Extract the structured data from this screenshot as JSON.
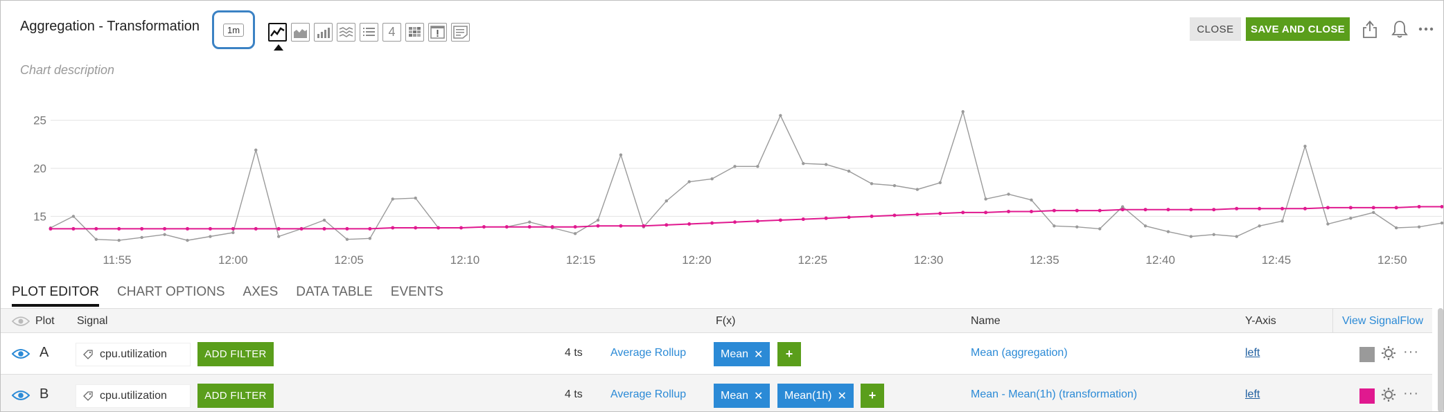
{
  "header": {
    "title": "Aggregation - Transformation",
    "resolution": "1m",
    "chart_type_count_label": "4",
    "close_label": "CLOSE",
    "save_label": "SAVE AND CLOSE",
    "icons": [
      "share-icon",
      "bell-icon",
      "more-icon"
    ]
  },
  "description_placeholder": "Chart description",
  "chart_data": {
    "type": "line",
    "x_labels": [
      "11:55",
      "12:00",
      "12:05",
      "12:10",
      "12:15",
      "12:20",
      "12:25",
      "12:30",
      "12:35",
      "12:40",
      "12:45",
      "12:50"
    ],
    "y_ticks": [
      15,
      20,
      25
    ],
    "ylim": [
      12,
      27
    ],
    "series": [
      {
        "color": "#9a9a9a",
        "values": [
          13.8,
          15.0,
          12.6,
          12.5,
          12.8,
          13.1,
          12.5,
          12.9,
          13.3,
          21.9,
          12.9,
          13.7,
          14.6,
          12.6,
          12.7,
          16.8,
          16.9,
          13.8,
          13.8,
          13.9,
          13.9,
          14.4,
          13.8,
          13.2,
          14.6,
          21.4,
          13.9,
          16.6,
          18.6,
          18.9,
          20.2,
          20.2,
          25.5,
          20.5,
          20.4,
          19.7,
          18.4,
          18.2,
          17.8,
          18.5,
          25.9,
          16.8,
          17.3,
          16.7,
          14.0,
          13.9,
          13.7,
          16.0,
          14.0,
          13.4,
          12.9,
          13.1,
          12.9,
          14.0,
          14.5,
          22.3,
          14.2,
          14.8,
          15.4,
          13.8,
          13.9,
          14.3
        ],
        "markers": true
      },
      {
        "color": "#e0198f",
        "values": [
          13.7,
          13.7,
          13.7,
          13.7,
          13.7,
          13.7,
          13.7,
          13.7,
          13.7,
          13.7,
          13.7,
          13.7,
          13.7,
          13.7,
          13.7,
          13.8,
          13.8,
          13.8,
          13.8,
          13.9,
          13.9,
          13.9,
          13.9,
          13.9,
          14.0,
          14.0,
          14.0,
          14.1,
          14.2,
          14.3,
          14.4,
          14.5,
          14.6,
          14.7,
          14.8,
          14.9,
          15.0,
          15.1,
          15.2,
          15.3,
          15.4,
          15.4,
          15.5,
          15.5,
          15.6,
          15.6,
          15.6,
          15.7,
          15.7,
          15.7,
          15.7,
          15.7,
          15.8,
          15.8,
          15.8,
          15.8,
          15.9,
          15.9,
          15.9,
          15.9,
          16.0,
          16.0
        ],
        "markers": true
      }
    ]
  },
  "tabs": [
    {
      "label": "PLOT EDITOR",
      "active": true
    },
    {
      "label": "CHART OPTIONS",
      "active": false
    },
    {
      "label": "AXES",
      "active": false
    },
    {
      "label": "DATA TABLE",
      "active": false
    },
    {
      "label": "EVENTS",
      "active": false
    }
  ],
  "table": {
    "headers": {
      "plot": "Plot",
      "signal": "Signal",
      "fx": "F(x)",
      "name": "Name",
      "yaxis": "Y-Axis",
      "signalflow": "View SignalFlow"
    },
    "rows": [
      {
        "letter": "A",
        "signal": "cpu.utilization",
        "add_filter": "ADD FILTER",
        "ts": "4 ts",
        "rollup": "Average Rollup",
        "functions": [
          "Mean"
        ],
        "name": "Mean (aggregation)",
        "yaxis": "left",
        "color": "#9a9a9a"
      },
      {
        "letter": "B",
        "signal": "cpu.utilization",
        "add_filter": "ADD FILTER",
        "ts": "4 ts",
        "rollup": "Average Rollup",
        "functions": [
          "Mean",
          "Mean(1h)"
        ],
        "name": "Mean - Mean(1h) (transformation)",
        "yaxis": "left",
        "color": "#e0198f"
      }
    ]
  }
}
